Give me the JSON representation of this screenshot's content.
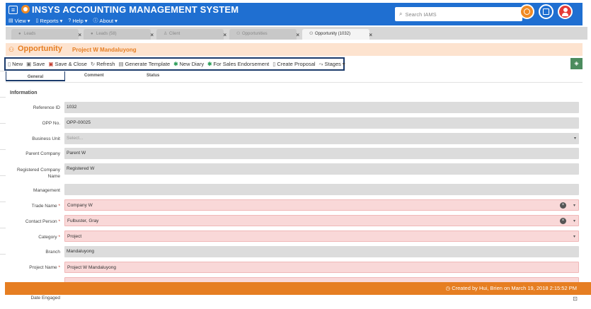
{
  "header": {
    "title": "INSYS ACCOUNTING MANAGEMENT SYSTEM",
    "menu": [
      "View",
      "Reports",
      "Help",
      "About"
    ],
    "search_placeholder": "Search IAMS"
  },
  "tabs": [
    {
      "label": "Leads",
      "active": false
    },
    {
      "label": "Leads (58)",
      "active": false
    },
    {
      "label": "Client",
      "active": false
    },
    {
      "label": "Opportunities",
      "active": false
    },
    {
      "label": "Opportunity (1032)",
      "active": true
    }
  ],
  "page": {
    "title": "Opportunity",
    "subtitle": "Project W Mandaluyong"
  },
  "toolbar": {
    "new": "New",
    "save": "Save",
    "save_close": "Save & Close",
    "refresh": "Refresh",
    "generate_template": "Generate Template",
    "new_diary": "New Diary",
    "for_sales_endorsement": "For Sales Endorsement",
    "create_proposal": "Create Proposal",
    "stages": "Stages"
  },
  "subtabs": [
    "General",
    "Comment",
    "Status"
  ],
  "form": {
    "section": "Information",
    "fields": [
      {
        "label": "Reference ID",
        "value": "1032",
        "required": false
      },
      {
        "label": "OPP No.",
        "value": "OPP-00025",
        "required": false
      },
      {
        "label": "Business Unit",
        "value": "Select...",
        "required": false
      },
      {
        "label": "Parent Company",
        "value": "Parent W",
        "required": false
      },
      {
        "label": "Registered Company Name",
        "value": "Registered W",
        "required": false
      },
      {
        "label": "Management",
        "value": "",
        "required": false
      },
      {
        "label": "Trade Name",
        "value": "Company W",
        "required": true
      },
      {
        "label": "Contact Person",
        "value": "Fulbuster, Gray",
        "required": true
      },
      {
        "label": "Category",
        "value": "Project",
        "required": true
      },
      {
        "label": "Branch",
        "value": "Mandaluyong",
        "required": false
      },
      {
        "label": "Project Name",
        "value": "Project W Mandaluyong",
        "required": true
      }
    ],
    "date_engaged_label": "Date Engaged"
  },
  "footer": {
    "created_text": "Created by Hui, Brien on March 19, 2018 2:15:52 PM"
  },
  "colors": {
    "header_blue": "#1f6fd1",
    "accent_orange": "#e67e22",
    "required_pink": "#f9d8d8"
  }
}
